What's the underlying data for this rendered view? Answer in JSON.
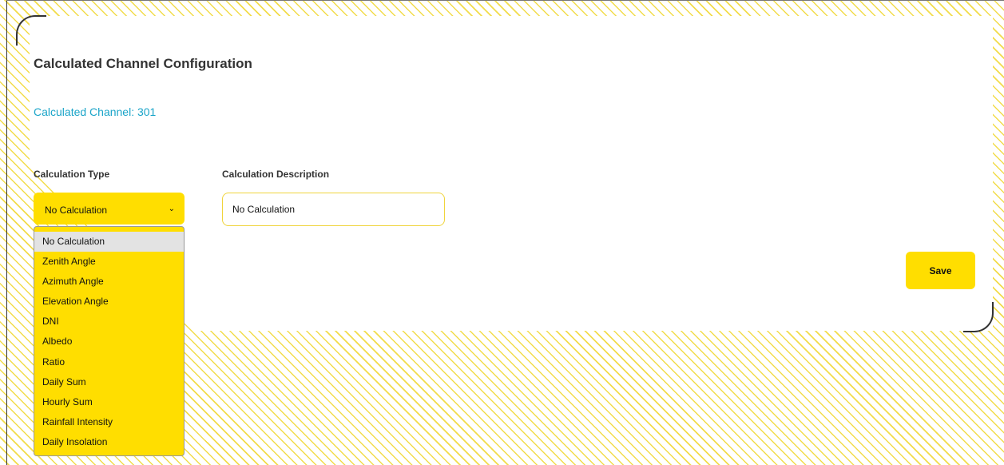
{
  "page": {
    "title": "Calculated Channel Configuration",
    "channel_label": "Calculated Channel: 301"
  },
  "form": {
    "calc_type_label": "Calculation Type",
    "calc_desc_label": "Calculation Description",
    "calc_type_value": "No Calculation",
    "calc_desc_value": "No Calculation",
    "save_label": "Save"
  },
  "dropdown": {
    "options": [
      "No Calculation",
      "Zenith Angle",
      "Azimuth Angle",
      "Elevation Angle",
      "DNI",
      "Albedo",
      "Ratio",
      "Daily Sum",
      "Hourly Sum",
      "Rainfall Intensity",
      "Daily Insolation"
    ],
    "selected_index": 0
  },
  "colors": {
    "accent": "#ffde00",
    "hatch": "#f2dc4a",
    "link": "#1ba5c9",
    "text": "#333333"
  },
  "icons": {
    "select_chevron": "chevron-down-icon"
  }
}
